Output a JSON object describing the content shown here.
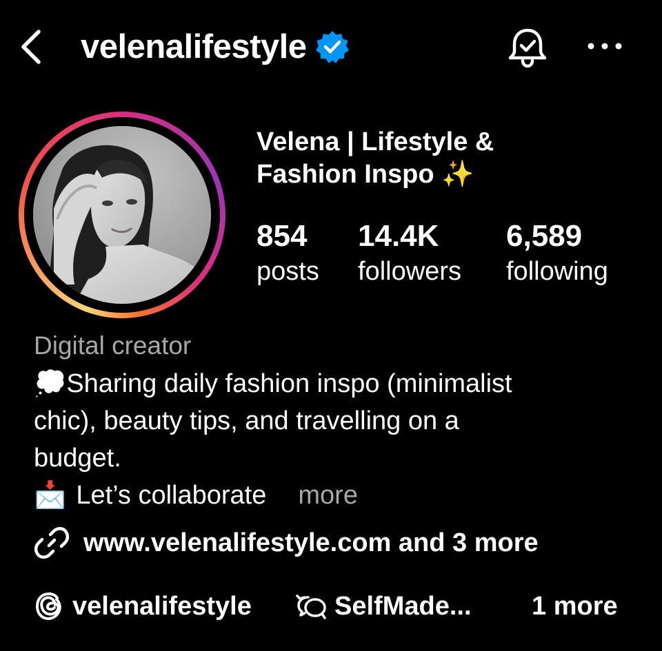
{
  "header": {
    "username": "velenalifestyle",
    "verified": true,
    "back_icon": "chevron-left-icon",
    "bell_icon": "bell-check-icon",
    "more_icon": "ellipsis-horizontal-icon"
  },
  "profile": {
    "display_name": "Velena | Lifestyle & Fashion Inspo ✨",
    "stats": [
      {
        "value": "854",
        "label": "posts"
      },
      {
        "value": "14.4K",
        "label": "followers"
      },
      {
        "value": "6,589",
        "label": "following"
      }
    ],
    "category": "Digital creator",
    "bio": {
      "line1": "💭Sharing daily fashion inspo (minimalist",
      "line2": "chic), beauty tips, and travelling on a",
      "line3": "budget.",
      "line4_emoji": "📩",
      "line4_text": "Let’s collaborate",
      "more_label": "more"
    },
    "link_text": "www.velenalifestyle.com and 3 more",
    "threads_handle": "velenalifestyle",
    "community_label": "SelfMade...",
    "extra_label": "1 more"
  },
  "colors": {
    "background": "#000000",
    "text": "#ffffff",
    "muted": "#a8a8a8",
    "verified_blue": "#0095f6",
    "ring_gradient": [
      "#fed373",
      "#f15245",
      "#d92e7f",
      "#9b36b7"
    ]
  }
}
